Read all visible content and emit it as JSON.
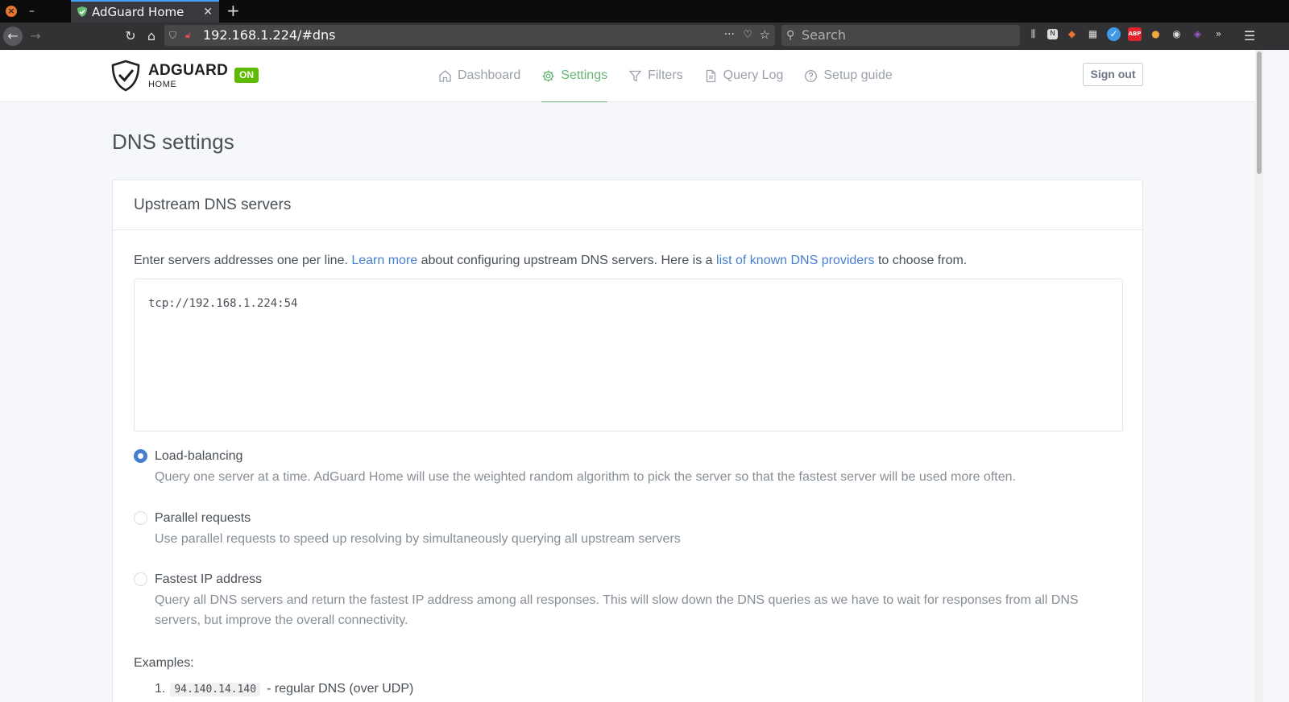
{
  "browser": {
    "tab_title": "AdGuard Home",
    "url": "192.168.1.224/#dns",
    "search_placeholder": "Search"
  },
  "app": {
    "logo_word": "ADGUARD",
    "logo_sub": "HOME",
    "status_badge": "ON",
    "nav": [
      {
        "label": "Dashboard",
        "icon": "home-icon",
        "active": false
      },
      {
        "label": "Settings",
        "icon": "gear-icon",
        "active": true
      },
      {
        "label": "Filters",
        "icon": "funnel-icon",
        "active": false
      },
      {
        "label": "Query Log",
        "icon": "document-icon",
        "active": false
      },
      {
        "label": "Setup guide",
        "icon": "help-circle-icon",
        "active": false
      }
    ],
    "sign_out": "Sign out",
    "accent_color": "#66b574",
    "link_color": "#467fcf"
  },
  "page": {
    "title": "DNS settings",
    "upstream": {
      "title": "Upstream DNS servers",
      "intro_1": "Enter servers addresses one per line. ",
      "learn_more": "Learn more",
      "intro_2": " about configuring upstream DNS servers. Here is a ",
      "providers_link": "list of known DNS providers",
      "intro_3": " to choose from.",
      "servers_value": "tcp://192.168.1.224:54",
      "modes": [
        {
          "label": "Load-balancing",
          "description": "Query one server at a time. AdGuard Home will use the weighted random algorithm to pick the server so that the fastest server will be used more often.",
          "checked": true
        },
        {
          "label": "Parallel requests",
          "description": "Use parallel requests to speed up resolving by simultaneously querying all upstream servers",
          "checked": false
        },
        {
          "label": "Fastest IP address",
          "description": "Query all DNS servers and return the fastest IP address among all responses. This will slow down the DNS queries as we have to wait for responses from all DNS servers, but improve the overall connectivity.",
          "checked": false
        }
      ],
      "examples_title": "Examples:",
      "examples": [
        {
          "num": "1.",
          "code": "94.140.14.140",
          "text": "- regular DNS (over UDP)"
        }
      ]
    }
  }
}
